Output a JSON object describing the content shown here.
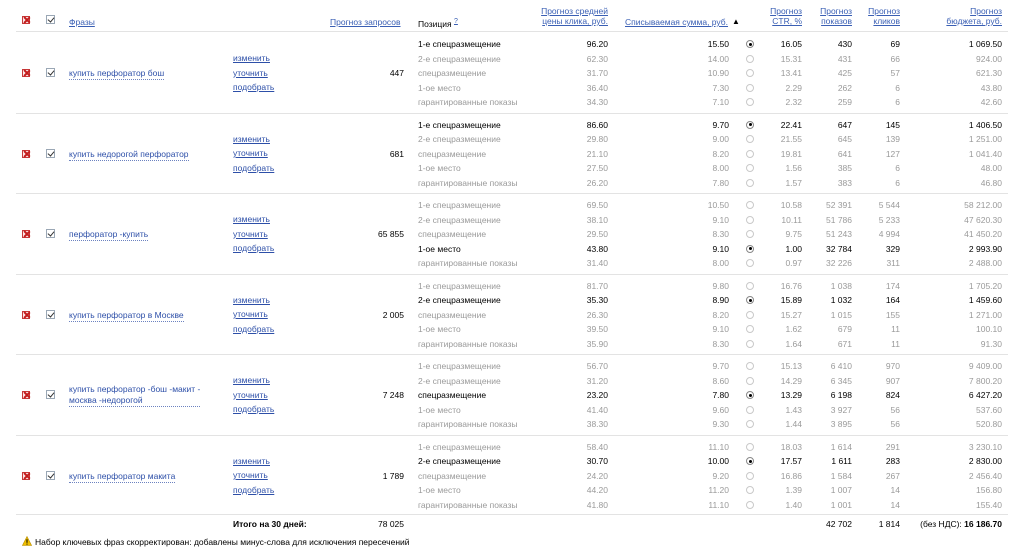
{
  "header": {
    "phrases": "Фразы",
    "forecast_queries": "Прогноз запросов",
    "position": "Позиция",
    "position_help": "?",
    "avg_cpc_line1": "Прогноз средней",
    "avg_cpc_line2": "цены клика, руб.",
    "charged_sum": "Списываемая сумма, руб.",
    "sort_arrow": "▲",
    "ctr_line1": "Прогноз",
    "ctr_line2": "CTR, %",
    "shows_line1": "Прогноз",
    "shows_line2": "показов",
    "clicks_line1": "Прогноз",
    "clicks_line2": "кликов",
    "budget_line1": "Прогноз",
    "budget_line2": "бюджета, руб."
  },
  "actions": {
    "change": "изменить",
    "refine": "уточнить",
    "pick": "подобрать"
  },
  "phrases": [
    {
      "phrase_lines": [
        "купить перфоратор бош"
      ],
      "queries": "447",
      "selected": 0,
      "rows": [
        {
          "pos": "1-е спецразмещение",
          "cpc": "96.20",
          "sum": "15.50",
          "ctr": "16.05",
          "shows": "430",
          "clicks": "69",
          "budget": "1 069.50"
        },
        {
          "pos": "2-е спецразмещение",
          "cpc": "62.30",
          "sum": "14.00",
          "ctr": "15.31",
          "shows": "431",
          "clicks": "66",
          "budget": "924.00"
        },
        {
          "pos": "спецразмещение",
          "cpc": "31.70",
          "sum": "10.90",
          "ctr": "13.41",
          "shows": "425",
          "clicks": "57",
          "budget": "621.30"
        },
        {
          "pos": "1-ое место",
          "cpc": "36.40",
          "sum": "7.30",
          "ctr": "2.29",
          "shows": "262",
          "clicks": "6",
          "budget": "43.80"
        },
        {
          "pos": "гарантированные показы",
          "cpc": "34.30",
          "sum": "7.10",
          "ctr": "2.32",
          "shows": "259",
          "clicks": "6",
          "budget": "42.60"
        }
      ]
    },
    {
      "phrase_lines": [
        "купить недорогой перфоратор"
      ],
      "queries": "681",
      "selected": 0,
      "rows": [
        {
          "pos": "1-е спецразмещение",
          "cpc": "86.60",
          "sum": "9.70",
          "ctr": "22.41",
          "shows": "647",
          "clicks": "145",
          "budget": "1 406.50"
        },
        {
          "pos": "2-е спецразмещение",
          "cpc": "29.80",
          "sum": "9.00",
          "ctr": "21.55",
          "shows": "645",
          "clicks": "139",
          "budget": "1 251.00"
        },
        {
          "pos": "спецразмещение",
          "cpc": "21.10",
          "sum": "8.20",
          "ctr": "19.81",
          "shows": "641",
          "clicks": "127",
          "budget": "1 041.40"
        },
        {
          "pos": "1-ое место",
          "cpc": "27.50",
          "sum": "8.00",
          "ctr": "1.56",
          "shows": "385",
          "clicks": "6",
          "budget": "48.00"
        },
        {
          "pos": "гарантированные показы",
          "cpc": "26.20",
          "sum": "7.80",
          "ctr": "1.57",
          "shows": "383",
          "clicks": "6",
          "budget": "46.80"
        }
      ]
    },
    {
      "phrase_lines": [
        "перфоратор -купить"
      ],
      "queries": "65 855",
      "selected": 3,
      "rows": [
        {
          "pos": "1-е спецразмещение",
          "cpc": "69.50",
          "sum": "10.50",
          "ctr": "10.58",
          "shows": "52 391",
          "clicks": "5 544",
          "budget": "58 212.00"
        },
        {
          "pos": "2-е спецразмещение",
          "cpc": "38.10",
          "sum": "9.10",
          "ctr": "10.11",
          "shows": "51 786",
          "clicks": "5 233",
          "budget": "47 620.30"
        },
        {
          "pos": "спецразмещение",
          "cpc": "29.50",
          "sum": "8.30",
          "ctr": "9.75",
          "shows": "51 243",
          "clicks": "4 994",
          "budget": "41 450.20"
        },
        {
          "pos": "1-ое место",
          "cpc": "43.80",
          "sum": "9.10",
          "ctr": "1.00",
          "shows": "32 784",
          "clicks": "329",
          "budget": "2 993.90"
        },
        {
          "pos": "гарантированные показы",
          "cpc": "31.40",
          "sum": "8.00",
          "ctr": "0.97",
          "shows": "32 226",
          "clicks": "311",
          "budget": "2 488.00"
        }
      ]
    },
    {
      "phrase_lines": [
        "купить перфоратор в Москве"
      ],
      "queries": "2 005",
      "selected": 1,
      "rows": [
        {
          "pos": "1-е спецразмещение",
          "cpc": "81.70",
          "sum": "9.80",
          "ctr": "16.76",
          "shows": "1 038",
          "clicks": "174",
          "budget": "1 705.20"
        },
        {
          "pos": "2-е спецразмещение",
          "cpc": "35.30",
          "sum": "8.90",
          "ctr": "15.89",
          "shows": "1 032",
          "clicks": "164",
          "budget": "1 459.60"
        },
        {
          "pos": "спецразмещение",
          "cpc": "26.30",
          "sum": "8.20",
          "ctr": "15.27",
          "shows": "1 015",
          "clicks": "155",
          "budget": "1 271.00"
        },
        {
          "pos": "1-ое место",
          "cpc": "39.50",
          "sum": "9.10",
          "ctr": "1.62",
          "shows": "679",
          "clicks": "11",
          "budget": "100.10"
        },
        {
          "pos": "гарантированные показы",
          "cpc": "35.90",
          "sum": "8.30",
          "ctr": "1.64",
          "shows": "671",
          "clicks": "11",
          "budget": "91.30"
        }
      ]
    },
    {
      "phrase_lines": [
        "купить перфоратор -бош -макит -",
        "москва -недорогой"
      ],
      "queries": "7 248",
      "selected": 2,
      "rows": [
        {
          "pos": "1-е спецразмещение",
          "cpc": "56.70",
          "sum": "9.70",
          "ctr": "15.13",
          "shows": "6 410",
          "clicks": "970",
          "budget": "9 409.00"
        },
        {
          "pos": "2-е спецразмещение",
          "cpc": "31.20",
          "sum": "8.60",
          "ctr": "14.29",
          "shows": "6 345",
          "clicks": "907",
          "budget": "7 800.20"
        },
        {
          "pos": "спецразмещение",
          "cpc": "23.20",
          "sum": "7.80",
          "ctr": "13.29",
          "shows": "6 198",
          "clicks": "824",
          "budget": "6 427.20"
        },
        {
          "pos": "1-ое место",
          "cpc": "41.40",
          "sum": "9.60",
          "ctr": "1.43",
          "shows": "3 927",
          "clicks": "56",
          "budget": "537.60"
        },
        {
          "pos": "гарантированные показы",
          "cpc": "38.30",
          "sum": "9.30",
          "ctr": "1.44",
          "shows": "3 895",
          "clicks": "56",
          "budget": "520.80"
        }
      ]
    },
    {
      "phrase_lines": [
        "купить перфоратор макита"
      ],
      "queries": "1 789",
      "selected": 1,
      "rows": [
        {
          "pos": "1-е спецразмещение",
          "cpc": "58.40",
          "sum": "11.10",
          "ctr": "18.03",
          "shows": "1 614",
          "clicks": "291",
          "budget": "3 230.10"
        },
        {
          "pos": "2-е спецразмещение",
          "cpc": "30.70",
          "sum": "10.00",
          "ctr": "17.57",
          "shows": "1 611",
          "clicks": "283",
          "budget": "2 830.00"
        },
        {
          "pos": "спецразмещение",
          "cpc": "24.20",
          "sum": "9.20",
          "ctr": "16.86",
          "shows": "1 584",
          "clicks": "267",
          "budget": "2 456.40"
        },
        {
          "pos": "1-ое место",
          "cpc": "44.20",
          "sum": "11.20",
          "ctr": "1.39",
          "shows": "1 007",
          "clicks": "14",
          "budget": "156.80"
        },
        {
          "pos": "гарантированные показы",
          "cpc": "41.80",
          "sum": "11.10",
          "ctr": "1.40",
          "shows": "1 001",
          "clicks": "14",
          "budget": "155.40"
        }
      ]
    }
  ],
  "totals": {
    "label": "Итого на 30 дней:",
    "queries": "78 025",
    "shows": "42 702",
    "clicks": "1 814",
    "budget_prefix": "(без НДС):",
    "budget": "16 186.70"
  },
  "notice": "Набор ключевых фраз скорректирован: добавлены минус-слова для исключения пересечений",
  "colors": {
    "link": "#2d4fa8",
    "dim_text": "#9a9a9a",
    "delete_red": "#c31d1d",
    "warning": "#e0a300"
  }
}
